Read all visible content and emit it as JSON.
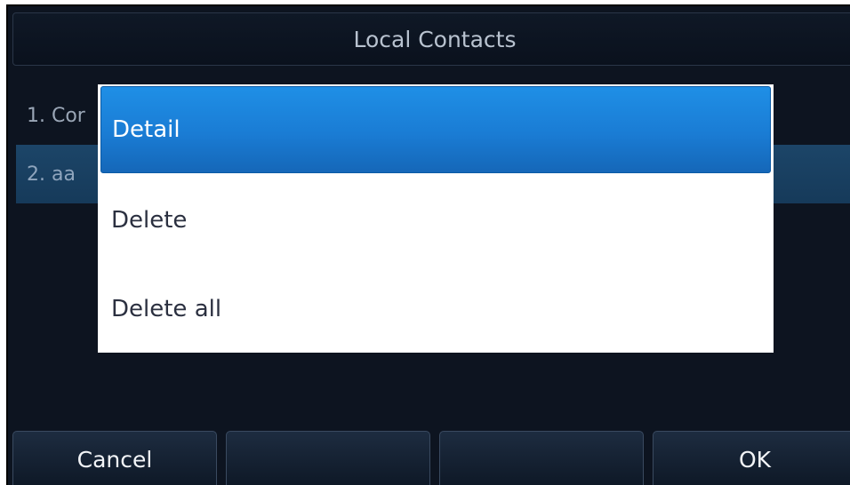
{
  "header": {
    "title": "Local Contacts"
  },
  "contacts": [
    {
      "label": "1. Cor"
    },
    {
      "label": "2. aa"
    }
  ],
  "popup_menu": {
    "items": [
      {
        "label": "Detail",
        "selected": true
      },
      {
        "label": "Delete",
        "selected": false
      },
      {
        "label": "Delete all",
        "selected": false
      }
    ]
  },
  "softkeys": [
    {
      "label": "Cancel"
    },
    {
      "label": ""
    },
    {
      "label": ""
    },
    {
      "label": "OK"
    }
  ],
  "colors": {
    "background": "#0d1420",
    "selected_row": "#1c4568",
    "menu_highlight": "#1a7cd4",
    "menu_background": "#ffffff"
  }
}
